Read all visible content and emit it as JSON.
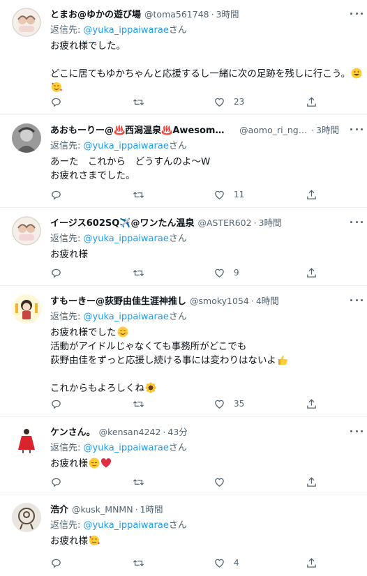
{
  "reply_prefix": "返信先: ",
  "reply_suffix": "さん",
  "tweets": [
    {
      "name": "とまお@ゆかの遊び場",
      "handle": "@toma561748",
      "time": "3時間",
      "reply_to": "@yuka_ippaiwarae",
      "lines": [
        "お疲れ様でした。",
        "",
        "どこに居てもゆかちゃんと応援するし一緒に次の足跡を残しに行こう。"
      ],
      "like_count": "23",
      "avatar": "illustration-avatar"
    },
    {
      "name": "あおもーりー@♨️西潟温泉♨️Awesome…",
      "handle": "@aomo_ri_ngt…",
      "time": "3時間",
      "reply_to": "@yuka_ippaiwarae",
      "lines": [
        "あーた　これから　どうすんのよ〜W",
        "お疲れさまでした。"
      ],
      "like_count": "11",
      "avatar": "photo-avatar"
    },
    {
      "name": "イージス602SQ✈️@ワンたん温泉",
      "handle": "@ASTER602",
      "time": "3時間",
      "reply_to": "@yuka_ippaiwarae",
      "lines": [
        "お疲れ様"
      ],
      "like_count": "9",
      "avatar": "illustration-avatar"
    },
    {
      "name": "すもーきー@荻野由佳生涯神推し",
      "handle": "@smoky1054",
      "time": "4時間",
      "reply_to": "@yuka_ippaiwarae",
      "lines": [
        "お疲れ様でした",
        "活動がアイドルじゃなくても事務所がどこでも",
        "荻野由佳をずっと応援し続ける事には変わりはないよ",
        "",
        "これからもよろしくね"
      ],
      "like_count": "35",
      "avatar": "character-avatar"
    },
    {
      "name": "ケンさん。",
      "handle": "@kensan4242",
      "time": "43分",
      "reply_to": "@yuka_ippaiwarae",
      "lines": [
        "お疲れ様"
      ],
      "like_count": "",
      "avatar": "figure-avatar"
    },
    {
      "name": "浩介",
      "handle": "@kusk_MNMN",
      "time": "1時間",
      "reply_to": "@yuka_ippaiwarae",
      "lines": [
        "お疲れ様"
      ],
      "like_count": "4",
      "avatar": "doodle-avatar"
    }
  ],
  "icons": {
    "reply": "reply-icon",
    "retweet": "retweet-icon",
    "like": "like-icon",
    "share": "share-icon",
    "more": "more-icon"
  },
  "colors": {
    "link": "#1d9bf0",
    "secondary_text": "#536471",
    "divider": "#eff3f4"
  }
}
